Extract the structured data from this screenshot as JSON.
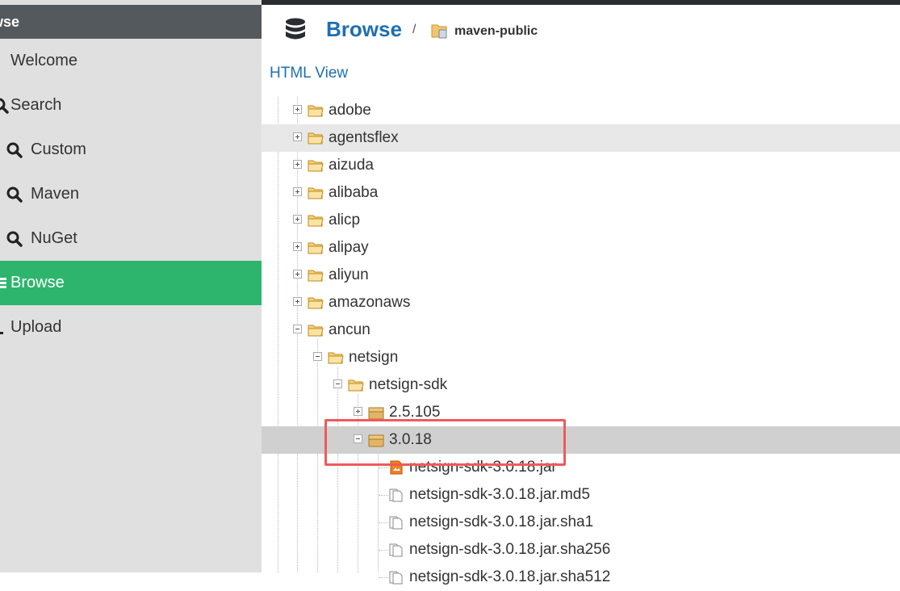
{
  "sidebar": {
    "header": "wse",
    "items": [
      {
        "label": "Welcome",
        "icon": "welcome-icon"
      },
      {
        "label": "Search",
        "icon": "search-icon"
      },
      {
        "label": "Custom",
        "icon": "search-icon"
      },
      {
        "label": "Maven",
        "icon": "search-icon"
      },
      {
        "label": "NuGet",
        "icon": "search-icon"
      },
      {
        "label": "Browse",
        "icon": "browse-icon",
        "active": true
      },
      {
        "label": "Upload",
        "icon": "upload-icon"
      }
    ]
  },
  "header": {
    "title": "Browse",
    "separator": "/",
    "repository": "maven-public",
    "html_view": "HTML View"
  },
  "tree": {
    "items": [
      {
        "label": "adobe",
        "type": "folder"
      },
      {
        "label": "agentsflex",
        "type": "folder"
      },
      {
        "label": "aizuda",
        "type": "folder"
      },
      {
        "label": "alibaba",
        "type": "folder"
      },
      {
        "label": "alicp",
        "type": "folder"
      },
      {
        "label": "alipay",
        "type": "folder"
      },
      {
        "label": "aliyun",
        "type": "folder"
      },
      {
        "label": "amazonaws",
        "type": "folder"
      },
      {
        "label": "ancun",
        "type": "folder"
      },
      {
        "label": "netsign",
        "type": "folder"
      },
      {
        "label": "netsign-sdk",
        "type": "folder"
      },
      {
        "label": "2.5.105",
        "type": "package"
      },
      {
        "label": "3.0.18",
        "type": "package"
      },
      {
        "label": "netsign-sdk-3.0.18.jar",
        "type": "jar"
      },
      {
        "label": "netsign-sdk-3.0.18.jar.md5",
        "type": "file"
      },
      {
        "label": "netsign-sdk-3.0.18.jar.sha1",
        "type": "file"
      },
      {
        "label": "netsign-sdk-3.0.18.jar.sha256",
        "type": "file"
      },
      {
        "label": "netsign-sdk-3.0.18.jar.sha512",
        "type": "file"
      }
    ]
  },
  "colors": {
    "accent": "#2db56d",
    "link": "#1f6fb3",
    "highlight": "#ef5a5a"
  }
}
